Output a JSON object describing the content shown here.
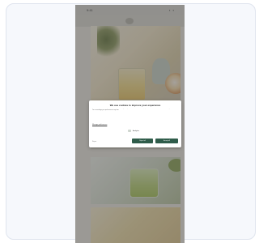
{
  "status_bar": {
    "time": "9:41",
    "icons": "wifi-icon battery-icon"
  },
  "cookie_modal": {
    "title": "We use cookies to improve your experience",
    "body": "We and our partners use cookies and similar technologies to personalise content and ads, to provide social media features and to analyse our traffic. You can manage your preferences at any time.",
    "settings_link": "Manage preferences",
    "option_label": "Analytics",
    "secondary_label": "Reject",
    "reject_button": "Reject all",
    "accept_button": "Accept all"
  },
  "colors": {
    "button_green": "#2f5c4a",
    "overlay": "rgba(60,60,60,0.45)",
    "card_border": "#dfe4ee"
  }
}
